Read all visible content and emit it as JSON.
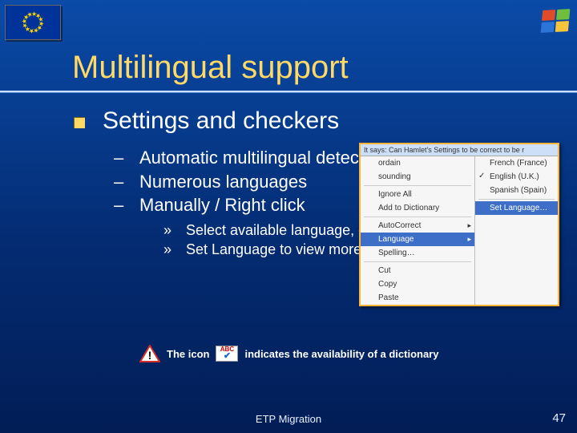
{
  "header": {
    "eu_flag_alt": "EU flag",
    "win_logo_alt": "Windows logo"
  },
  "title": "Multilingual support",
  "section": {
    "heading": "Settings and checkers",
    "bullets": [
      "Automatic multilingual detection",
      "Numerous languages",
      "Manually / Right click"
    ],
    "subbullets": [
      "Select available language, or",
      "Set Language to view more"
    ]
  },
  "context_menu": {
    "titlebar": "It says: Can Hamlet's Settings to be correct to be r",
    "left_items": [
      "ordain",
      "sounding",
      "Ignore All",
      "Add to Dictionary",
      "AutoCorrect",
      "Language",
      "Spelling…",
      "Cut",
      "Copy",
      "Paste"
    ],
    "highlight_left": "Language",
    "right_items": [
      "French (France)",
      "English (U.K.)",
      "Spanish (Spain)",
      "Set Language…"
    ],
    "checked_right": "English (U.K.)",
    "highlight_right": "Set Language…"
  },
  "note": {
    "pre": "The icon",
    "post": "indicates the availability of a dictionary",
    "abc_label": "ABC"
  },
  "footer": "ETP Migration",
  "page_number": "47"
}
